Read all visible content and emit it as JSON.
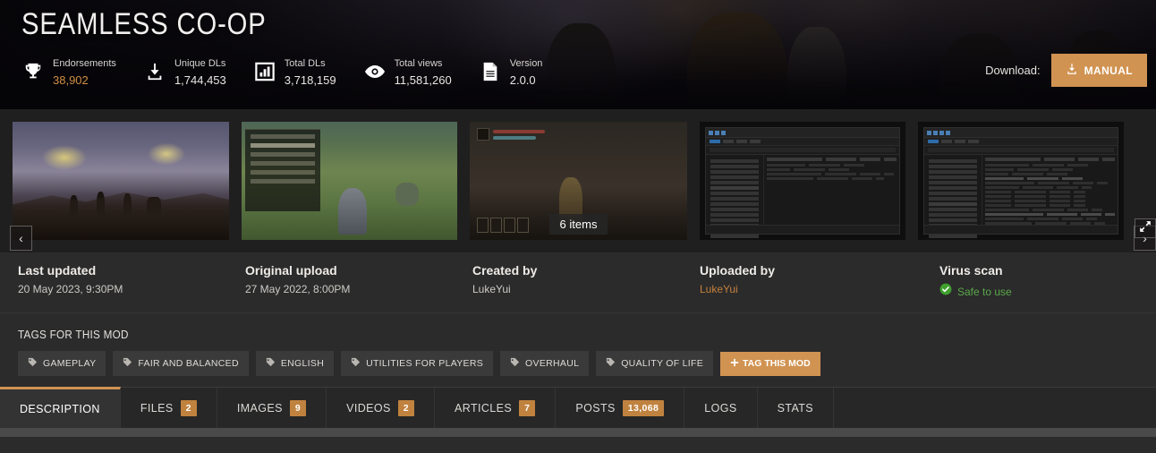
{
  "header": {
    "title": "SEAMLESS CO-OP",
    "stats": [
      {
        "icon": "trophy-icon",
        "label": "Endorsements",
        "value": "38,902",
        "accent": true
      },
      {
        "icon": "download-icon",
        "label": "Unique DLs",
        "value": "1,744,453",
        "accent": false
      },
      {
        "icon": "bar-chart-icon",
        "label": "Total DLs",
        "value": "3,718,159",
        "accent": false
      },
      {
        "icon": "eye-icon",
        "label": "Total views",
        "value": "11,581,260",
        "accent": false
      },
      {
        "icon": "document-icon",
        "label": "Version",
        "value": "2.0.0",
        "accent": false
      }
    ],
    "download_label": "Download:",
    "download_button": "MANUAL",
    "accent_color": "#d19352"
  },
  "gallery": {
    "item_count_badge": "6 items",
    "prev_label": "‹",
    "next_label": "›",
    "thumbs": [
      {
        "name": "screenshot-landscape"
      },
      {
        "name": "screenshot-grass-menu"
      },
      {
        "name": "screenshot-interior"
      },
      {
        "name": "screenshot-explorer-1"
      },
      {
        "name": "screenshot-explorer-2"
      }
    ]
  },
  "meta": {
    "last_updated": {
      "title": "Last updated",
      "value": "20 May 2023,  9:30PM"
    },
    "original_upload": {
      "title": "Original upload",
      "value": "27 May 2022,  8:00PM"
    },
    "created_by": {
      "title": "Created by",
      "value": "LukeYui"
    },
    "uploaded_by": {
      "title": "Uploaded by",
      "value": "LukeYui"
    },
    "virus_scan": {
      "title": "Virus scan",
      "value": "Safe to use",
      "status_color": "#5aa84a"
    }
  },
  "tags": {
    "heading": "TAGS FOR THIS MOD",
    "items": [
      "GAMEPLAY",
      "FAIR AND BALANCED",
      "ENGLISH",
      "UTILITIES FOR PLAYERS",
      "OVERHAUL",
      "QUALITY OF LIFE"
    ],
    "add_label": "TAG THIS MOD"
  },
  "tabs": [
    {
      "label": "DESCRIPTION",
      "badge": "",
      "active": true
    },
    {
      "label": "FILES",
      "badge": "2",
      "active": false
    },
    {
      "label": "IMAGES",
      "badge": "9",
      "active": false
    },
    {
      "label": "VIDEOS",
      "badge": "2",
      "active": false
    },
    {
      "label": "ARTICLES",
      "badge": "7",
      "active": false
    },
    {
      "label": "POSTS",
      "badge": "13,068",
      "active": false
    },
    {
      "label": "LOGS",
      "badge": "",
      "active": false
    },
    {
      "label": "STATS",
      "badge": "",
      "active": false
    }
  ]
}
